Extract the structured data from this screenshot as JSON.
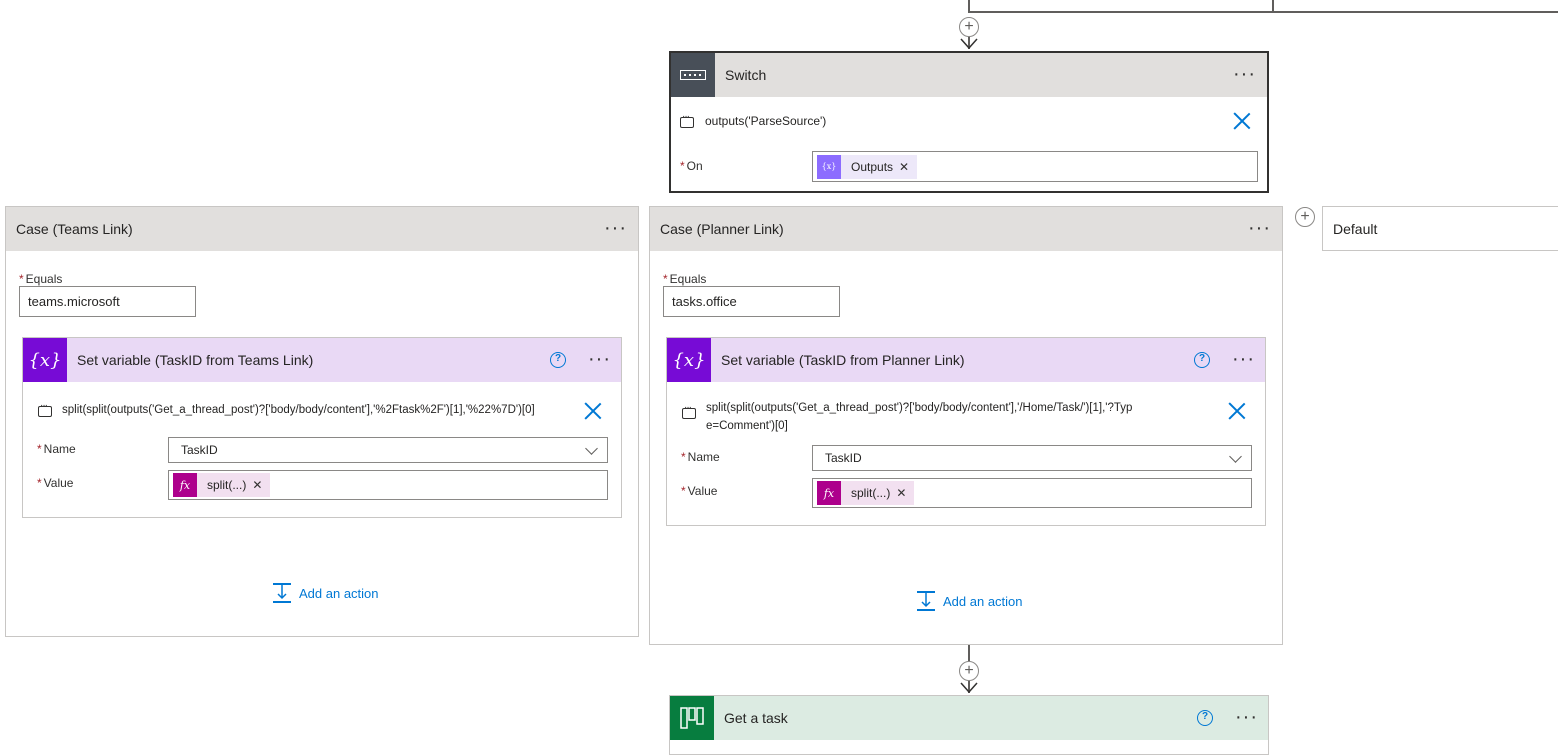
{
  "switch": {
    "title": "Switch",
    "expression": "outputs('ParseSource')",
    "on_label": "On",
    "on_token": "Outputs"
  },
  "cases": [
    {
      "title": "Case (Teams Link)",
      "equals_label": "Equals",
      "equals_value": "teams.microsoft",
      "action": {
        "title": "Set variable (TaskID from Teams Link)",
        "expression": "split(split(outputs('Get_a_thread_post')?['body/body/content'],'%2Ftask%2F')[1],'%22%7D')[0]",
        "name_label": "Name",
        "name_value": "TaskID",
        "value_label": "Value",
        "value_token": "split(...)"
      },
      "add_action": "Add an action"
    },
    {
      "title": "Case (Planner Link)",
      "equals_label": "Equals",
      "equals_value": "tasks.office",
      "action": {
        "title": "Set variable (TaskID from Planner Link)",
        "expression": "split(split(outputs('Get_a_thread_post')?['body/body/content'],'/Home/Task/')[1],'?Type=Comment')[0]",
        "name_label": "Name",
        "name_value": "TaskID",
        "value_label": "Value",
        "value_token": "split(...)"
      },
      "add_action": "Add an action"
    }
  ],
  "default_case": {
    "title": "Default"
  },
  "get_task": {
    "title": "Get a task"
  },
  "icons": {
    "switch": "switch-icon",
    "variable": "variable-icon",
    "expression": "fx-icon",
    "planner": "planner-icon",
    "comment": "comment-icon",
    "help": "help-icon",
    "close": "close-icon",
    "more": "more-icon",
    "add": "plus-icon",
    "add_action": "add-action-icon"
  },
  "colors": {
    "switch_header": "#e1dfdd",
    "switch_icon_bg": "#484f58",
    "variable_header": "#e9d9f5",
    "variable_icon_bg": "#770bd6",
    "fx_token_bg": "#ad008c",
    "outputs_token_bg": "#8c6cff",
    "planner_header": "#dcebe2",
    "planner_icon_bg": "#077d3f",
    "link": "#0078d4"
  }
}
